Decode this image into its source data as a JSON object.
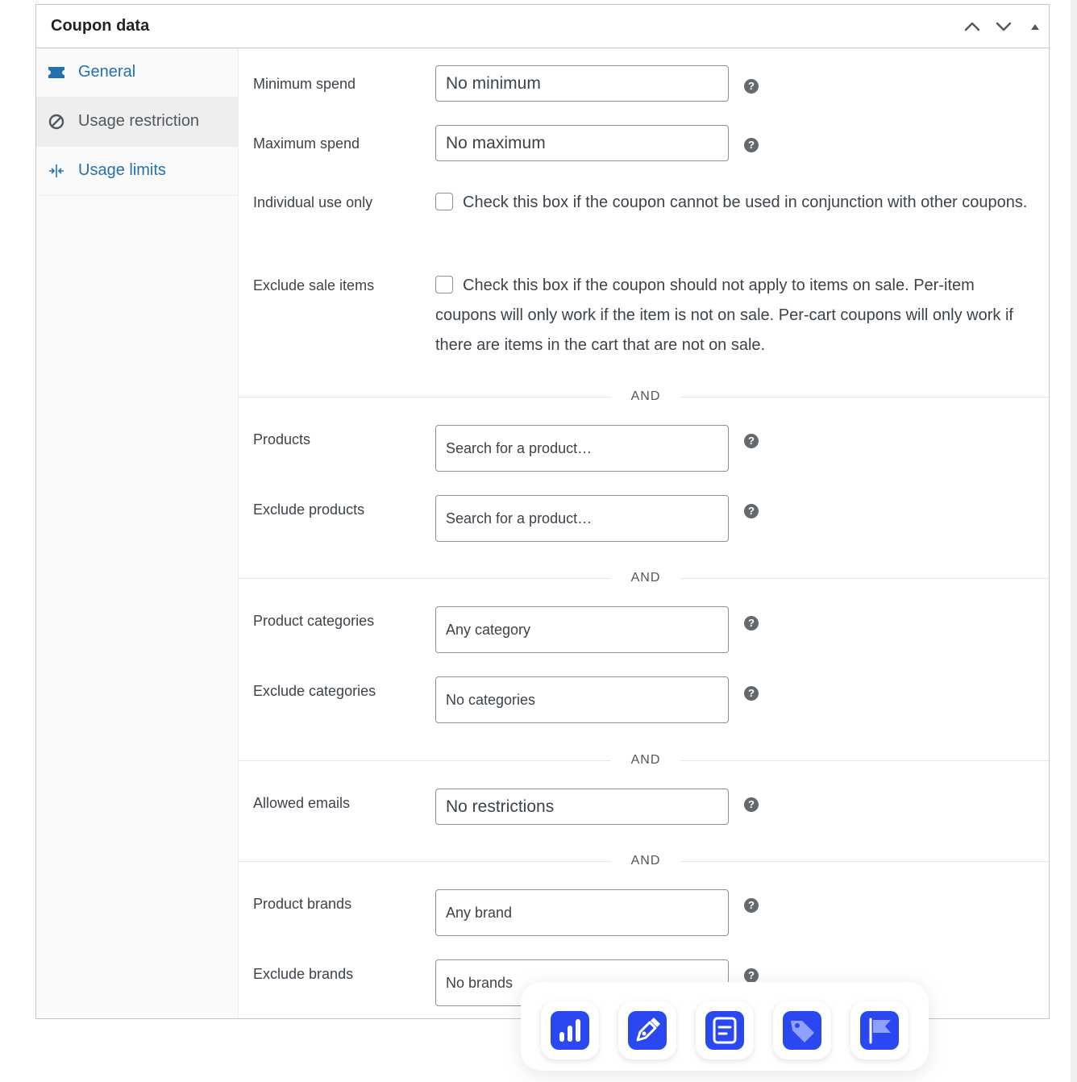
{
  "panel": {
    "title": "Coupon data"
  },
  "tabs": [
    {
      "label": "General",
      "icon": "ticket-icon",
      "active": false
    },
    {
      "label": "Usage restriction",
      "icon": "block-icon",
      "active": true
    },
    {
      "label": "Usage limits",
      "icon": "arrows-in-icon",
      "active": false
    }
  ],
  "fields": {
    "min_spend": {
      "label": "Minimum spend",
      "placeholder": "No minimum"
    },
    "max_spend": {
      "label": "Maximum spend",
      "placeholder": "No maximum"
    },
    "individual_use": {
      "label": "Individual use only",
      "description": "Check this box if the coupon cannot be used in conjunction with other coupons."
    },
    "exclude_sale": {
      "label": "Exclude sale items",
      "description": "Check this box if the coupon should not apply to items on sale. Per-item coupons will only work if the item is not on sale. Per-cart coupons will only work if there are items in the cart that are not on sale."
    },
    "products": {
      "label": "Products",
      "placeholder": "Search for a product…"
    },
    "exclude_products": {
      "label": "Exclude products",
      "placeholder": "Search for a product…"
    },
    "product_categories": {
      "label": "Product categories",
      "placeholder": "Any category"
    },
    "exclude_categories": {
      "label": "Exclude categories",
      "placeholder": "No categories"
    },
    "allowed_emails": {
      "label": "Allowed emails",
      "placeholder": "No restrictions"
    },
    "product_brands": {
      "label": "Product brands",
      "placeholder": "Any brand"
    },
    "exclude_brands": {
      "label": "Exclude brands",
      "placeholder": "No brands"
    }
  },
  "separator_label": "AND",
  "help_glyph": "?",
  "dock": [
    {
      "icon": "chart-bar-icon"
    },
    {
      "icon": "pen-icon"
    },
    {
      "icon": "document-icon"
    },
    {
      "icon": "tag-icon"
    },
    {
      "icon": "flag-icon"
    }
  ],
  "colors": {
    "link": "#2271b1",
    "accent": "#2b48f0",
    "border": "#8c8f94"
  }
}
